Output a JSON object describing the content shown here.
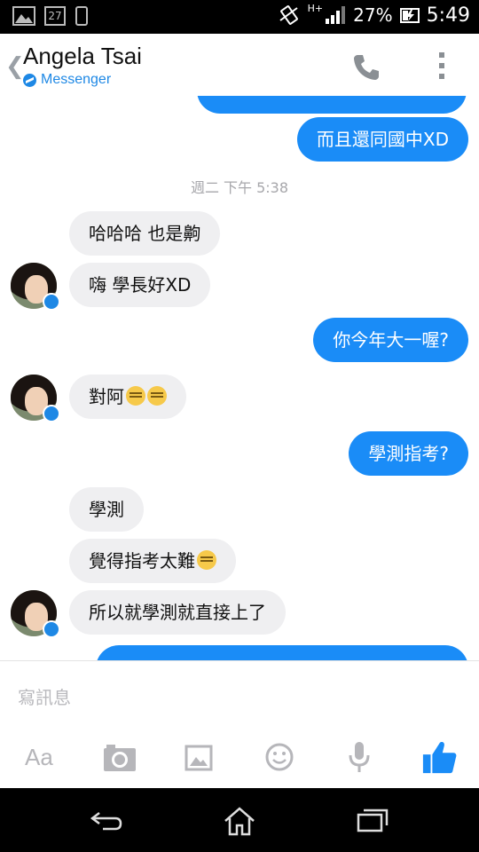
{
  "status_bar": {
    "battery_percent": "27%",
    "time": "5:49",
    "calendar_day": "27",
    "network_label": "H+"
  },
  "header": {
    "back_icon": "chevron-left-icon",
    "contact_name": "Angela Tsai",
    "subtitle": "Messenger",
    "call_icon": "phone-icon",
    "more_icon": "more-vertical-icon"
  },
  "conversation": {
    "timestamp": "週二 下午 5:38",
    "messages": [
      {
        "from": "me",
        "text": "而且還同國中XD"
      },
      {
        "from": "them",
        "text": "哈哈哈 也是齁"
      },
      {
        "from": "them",
        "text": "嗨 學長好XD"
      },
      {
        "from": "me",
        "text": "你今年大一喔?"
      },
      {
        "from": "them",
        "text": "對阿"
      },
      {
        "from": "me",
        "text": "學測指考?"
      },
      {
        "from": "them",
        "text": "學測"
      },
      {
        "from": "them",
        "text": "覺得指考太難"
      },
      {
        "from": "them",
        "text": "所以就學測就直接上了"
      }
    ]
  },
  "composer": {
    "placeholder": "寫訊息",
    "tools": [
      "text-format-icon",
      "camera-icon",
      "image-icon",
      "emoji-icon",
      "microphone-icon",
      "thumbs-up-icon"
    ],
    "text_tool_label": "Aa"
  },
  "colors": {
    "accent": "#1a8cf7",
    "incoming_bubble": "#efeff1",
    "subtitle": "#1e88e5"
  },
  "navbar": {
    "icons": [
      "back-icon",
      "home-icon",
      "recents-icon"
    ]
  }
}
